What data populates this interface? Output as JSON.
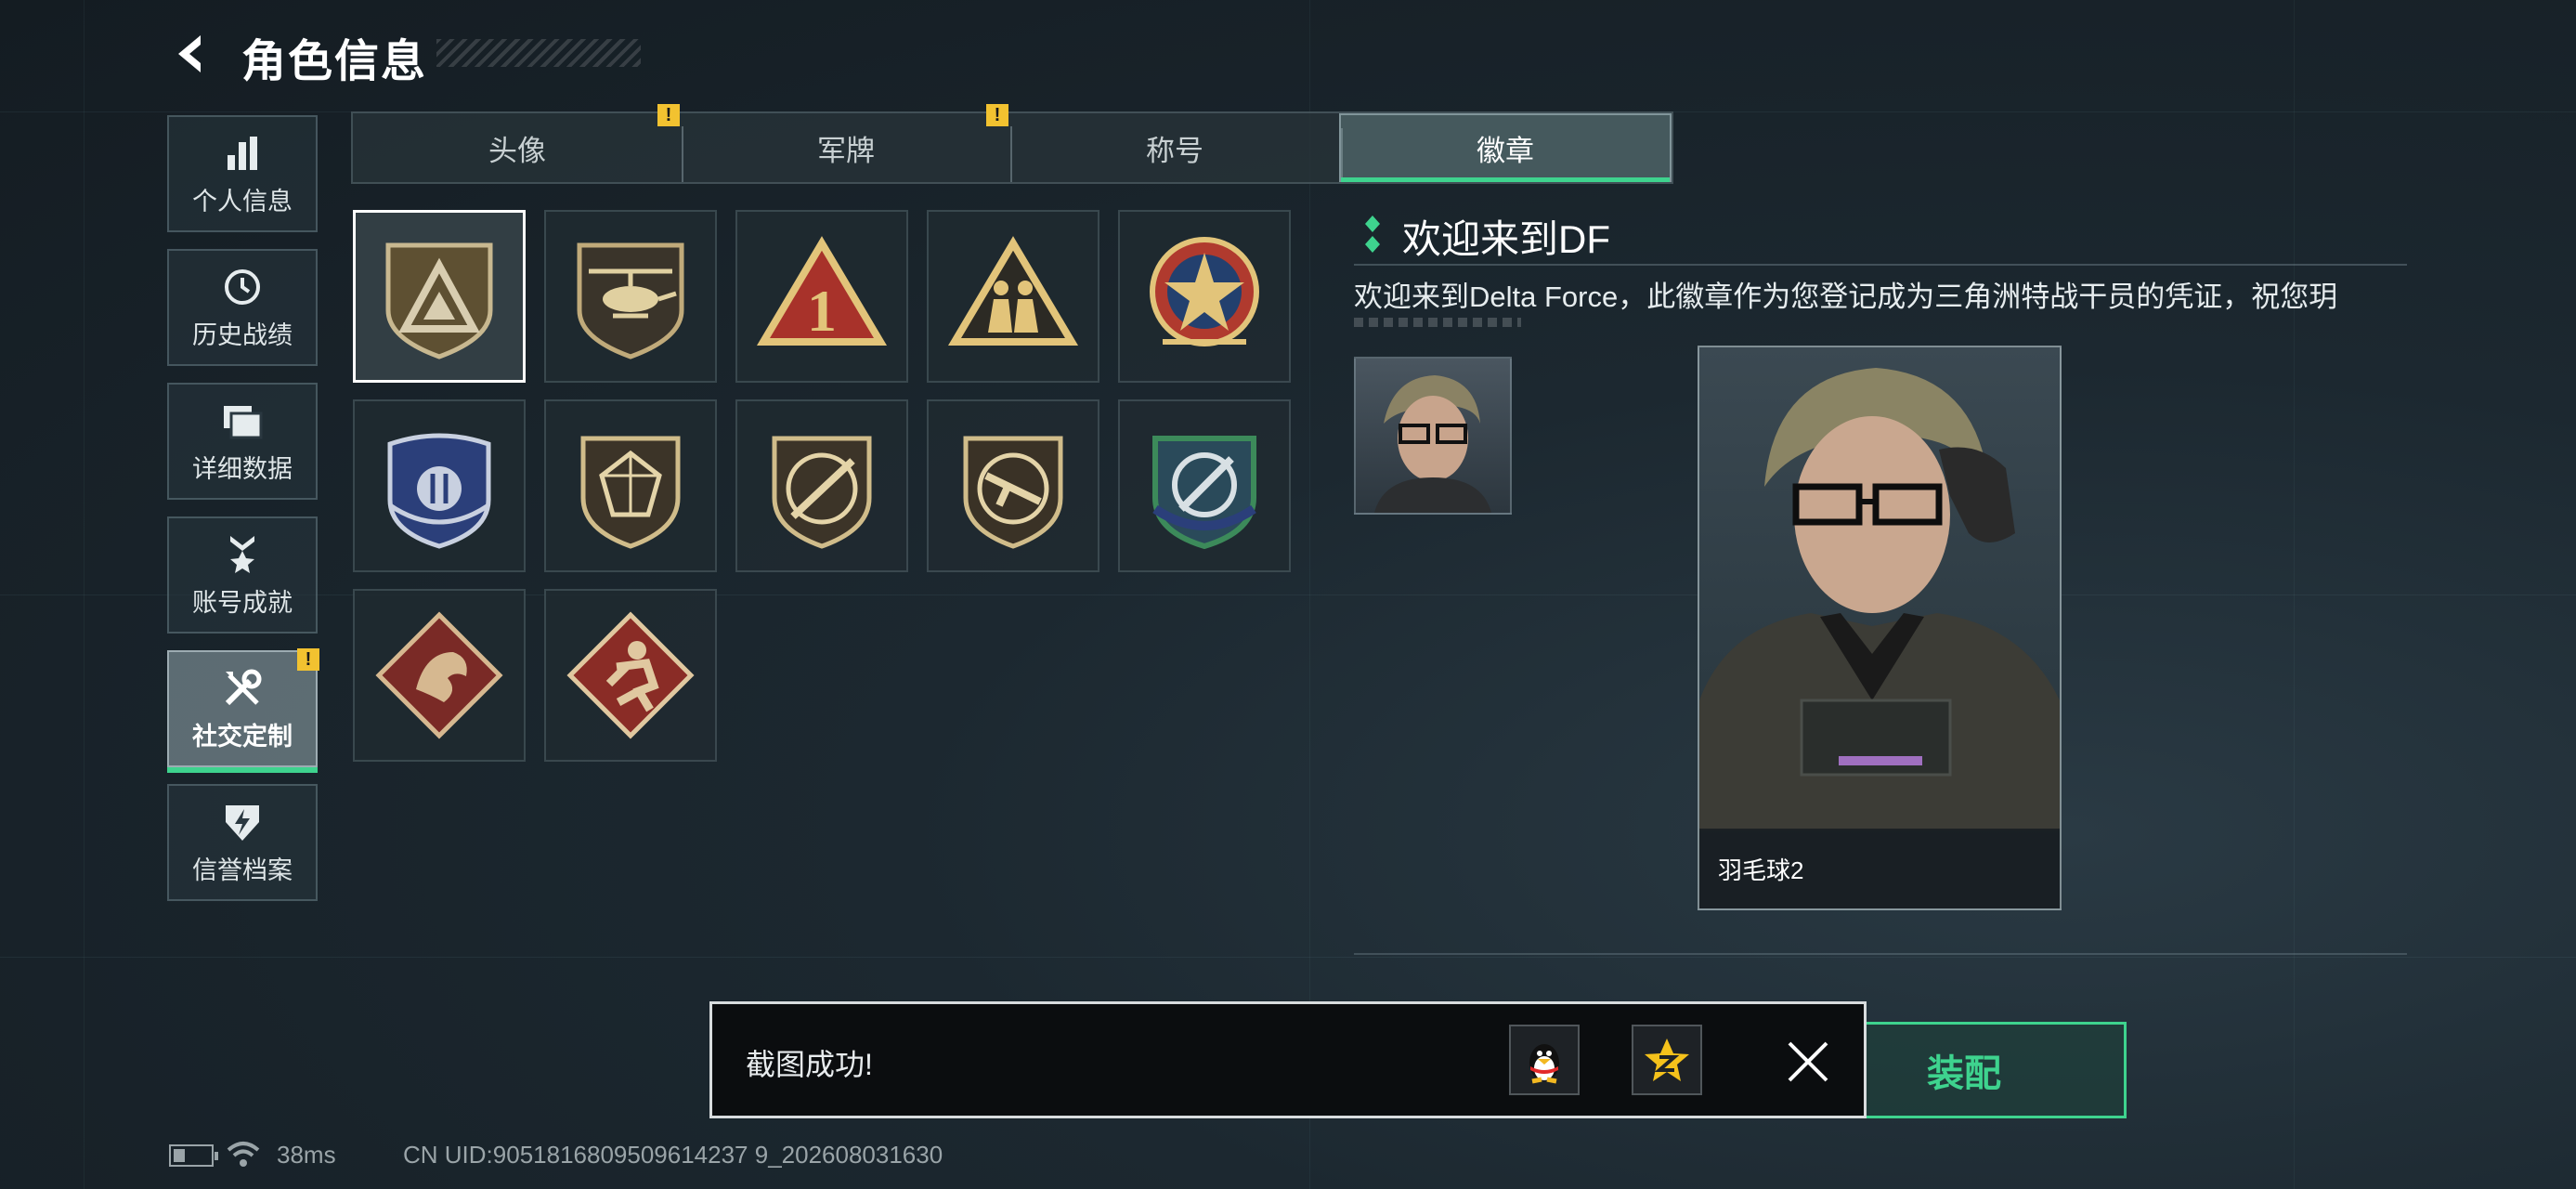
{
  "header": {
    "title": "角色信息"
  },
  "sidebar": {
    "items": [
      {
        "label": "个人信息",
        "icon": "bar-chart-icon"
      },
      {
        "label": "历史战绩",
        "icon": "clock-icon"
      },
      {
        "label": "详细数据",
        "icon": "folders-icon"
      },
      {
        "label": "账号成就",
        "icon": "medal-icon"
      },
      {
        "label": "社交定制",
        "icon": "tools-icon",
        "active": true,
        "alert": "!"
      },
      {
        "label": "信誉档案",
        "icon": "shield-lightning-icon"
      }
    ]
  },
  "tabs": [
    {
      "label": "头像",
      "alert": "!"
    },
    {
      "label": "军牌",
      "alert": "!"
    },
    {
      "label": "称号"
    },
    {
      "label": "徽章",
      "active": true
    }
  ],
  "badges": [
    {
      "name": "delta-triangle-badge",
      "selected": true
    },
    {
      "name": "helicopter-badge"
    },
    {
      "name": "number-one-triangle-badge"
    },
    {
      "name": "soldiers-triangle-badge"
    },
    {
      "name": "star-emblem-badge"
    },
    {
      "name": "blue-wings-badge"
    },
    {
      "name": "gem-shield-badge"
    },
    {
      "name": "rifle-shield-badge"
    },
    {
      "name": "smg-shield-badge"
    },
    {
      "name": "crosshair-knife-badge"
    },
    {
      "name": "dragon-diamond-badge"
    },
    {
      "name": "runner-diamond-badge"
    }
  ],
  "detail": {
    "title": "欢迎来到DF",
    "description": "欢迎来到Delta Force，此徽章作为您登记成为三角洲特战干员的凭证，祝您玥",
    "character_name": "羽毛球2",
    "equip_label": "装配"
  },
  "toast": {
    "message": "截图成功!",
    "share_qq_icon": "qq-penguin-icon",
    "share_qzone_icon": "qzone-star-icon"
  },
  "status": {
    "ping": "38ms",
    "uid": "CN UID:9051816809509614237 9_202608031630"
  },
  "colors": {
    "accent": "#3ed38e",
    "alert": "#f2c230",
    "background": "#1c2830"
  }
}
